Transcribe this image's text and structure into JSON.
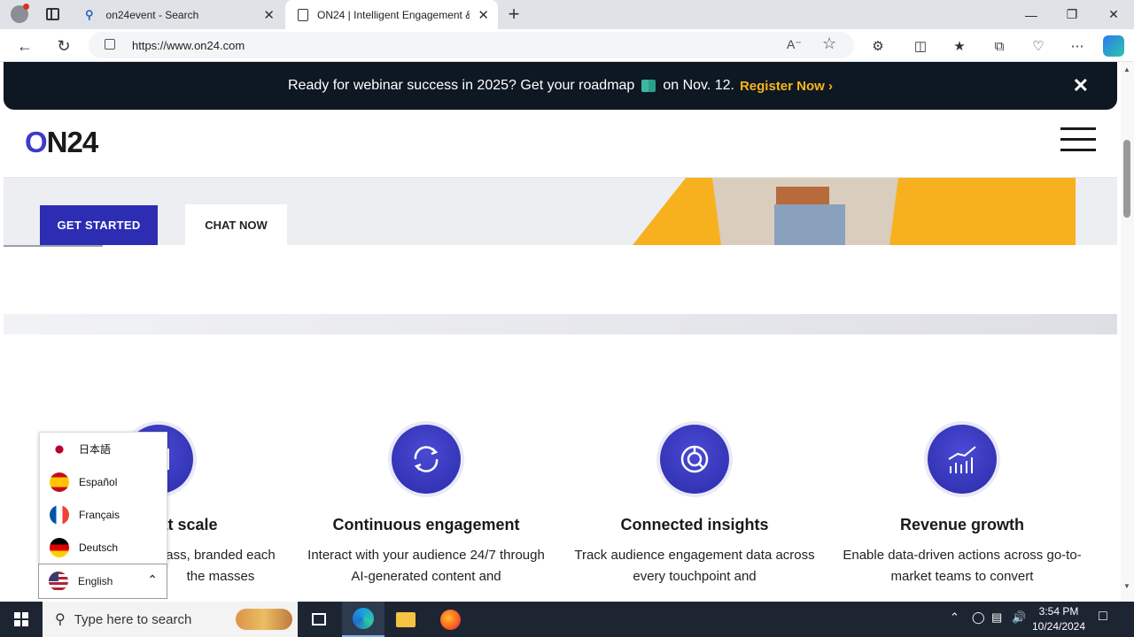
{
  "browser": {
    "tabs": [
      {
        "title": "on24event - Search",
        "active": false
      },
      {
        "title": "ON24 | Intelligent Engagement &",
        "active": true
      }
    ],
    "url": "https://www.on24.com",
    "new_tab_glyph": "+",
    "tab_close_glyph": "✕",
    "window_controls": {
      "minimize": "—",
      "maximize": "❐",
      "close": "✕"
    }
  },
  "promo_banner": {
    "text": "Ready for webinar success in 2025? Get your roadmap",
    "date_text": "on Nov. 12.",
    "cta": "Register Now ›",
    "close": "✕"
  },
  "site": {
    "logo": {
      "o": "O",
      "rest": "N24"
    },
    "hero": {
      "primary_button": "GET STARTED",
      "secondary_button": "CHAT NOW"
    },
    "features": [
      {
        "title": "on at scale",
        "desc": "ass, branded each the masses"
      },
      {
        "title": "Continuous engagement",
        "desc": "Interact with your audience 24/7 through AI-generated content and"
      },
      {
        "title": "Connected insights",
        "desc": "Track audience engagement data across every touchpoint and"
      },
      {
        "title": "Revenue growth",
        "desc": "Enable data-driven actions across go-to-market teams to convert"
      }
    ]
  },
  "language_menu": {
    "options": [
      {
        "label": "日本語",
        "flag": "japan-flag"
      },
      {
        "label": "Español",
        "flag": "spain-flag"
      },
      {
        "label": "Français",
        "flag": "france-flag"
      },
      {
        "label": "Deutsch",
        "flag": "germany-flag"
      }
    ],
    "selected": "English"
  },
  "taskbar": {
    "search_placeholder": "Type here to search",
    "time": "3:54 PM",
    "date": "10/24/2024"
  },
  "colors": {
    "brand_blue": "#2d2db3",
    "promo_bg": "#0e1822",
    "promo_cta": "#f9b41b",
    "hero_yellow": "#f7b11e"
  }
}
